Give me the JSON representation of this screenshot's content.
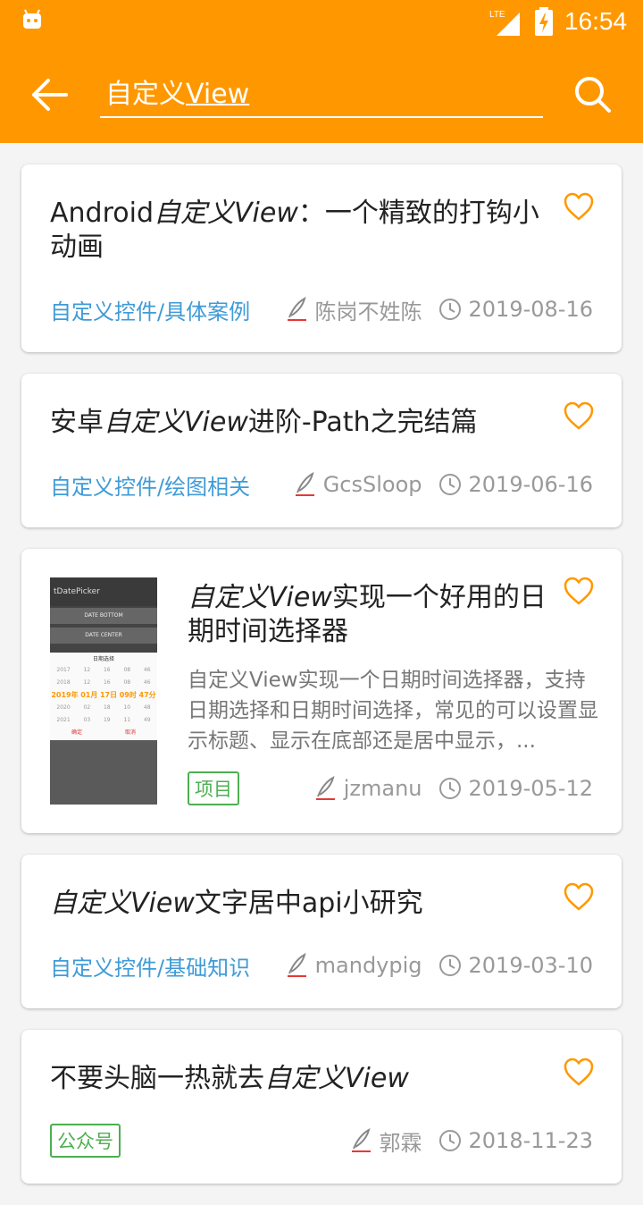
{
  "status_bar": {
    "network": "LTE",
    "time": "16:54"
  },
  "toolbar": {
    "query_prefix": "自定义",
    "query_underlined": "View"
  },
  "articles": [
    {
      "title_pre": "Android",
      "title_em": "自定义View",
      "title_post": "：一个精致的打钩小动画",
      "category": "自定义控件/具体案例",
      "author": "陈岗不姓陈",
      "date": "2019-08-16"
    },
    {
      "title_pre": "安卓",
      "title_em": "自定义View",
      "title_post": "进阶-Path之完结篇",
      "category": "自定义控件/绘图相关",
      "author": "GcsSloop",
      "date": "2019-06-16"
    },
    {
      "title_pre": "",
      "title_em": "自定义View",
      "title_post": "实现一个好用的日期时间选择器",
      "description": "自定义View实现一个日期时间选择器，支持日期选择和日期时间选择，常见的可以设置显示标题、显示在底部还是居中显示，...",
      "tag": "项目",
      "author": "jzmanu",
      "date": "2019-05-12",
      "thumbnail": {
        "title": "tDatePicker",
        "buttons": [
          "DATE BOTTOM",
          "DATE CENTER"
        ],
        "caption": "日期选择",
        "rows": [
          [
            "2017",
            "12",
            "16",
            "08",
            "46"
          ],
          [
            "2018",
            "12",
            "16",
            "08",
            "46"
          ],
          [
            "2019年",
            "01月",
            "17日",
            "09时",
            "47分"
          ],
          [
            "2020",
            "02",
            "18",
            "10",
            "48"
          ],
          [
            "2021",
            "03",
            "19",
            "11",
            "49"
          ]
        ],
        "actions": [
          "确定",
          "取消"
        ]
      }
    },
    {
      "title_pre": "",
      "title_em": "自定义View",
      "title_post": "文字居中api小研究",
      "category": "自定义控件/基础知识",
      "author": "mandypig",
      "date": "2019-03-10"
    },
    {
      "title_pre": "不要头脑一热就去",
      "title_em": "自定义View",
      "title_post": "",
      "tag": "公众号",
      "author": "郭霖",
      "date": "2018-11-23"
    }
  ]
}
